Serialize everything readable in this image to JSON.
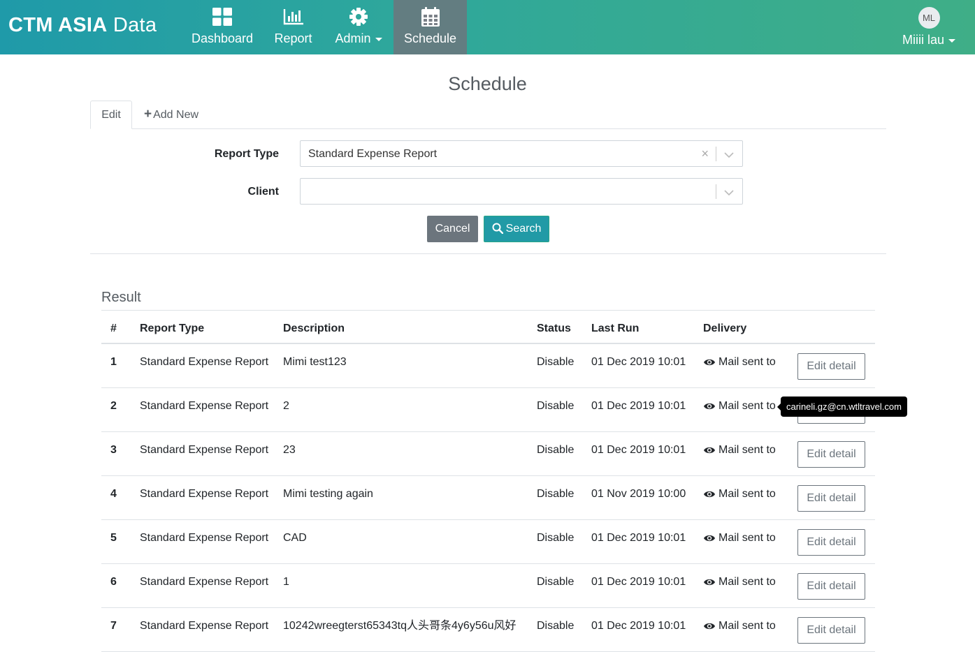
{
  "navbar": {
    "brand_bold": "CTM ASIA",
    "brand_rest": " Data",
    "items": [
      {
        "label": "Dashboard",
        "icon": "dashboard-grid-icon"
      },
      {
        "label": "Report",
        "icon": "bar-chart-icon"
      },
      {
        "label": "Admin",
        "icon": "gear-icon",
        "dropdown": true
      },
      {
        "label": "Schedule",
        "icon": "calendar-icon",
        "active": true
      }
    ],
    "user": {
      "initials": "ML",
      "name": "Miiii lau"
    }
  },
  "page": {
    "title": "Schedule"
  },
  "tabs": {
    "edit": "Edit",
    "add_new": "Add New"
  },
  "form": {
    "report_type_label": "Report Type",
    "report_type_value": "Standard Expense Report",
    "client_label": "Client",
    "client_value": "",
    "cancel_label": "Cancel",
    "search_label": "Search"
  },
  "result": {
    "title": "Result",
    "headers": [
      "#",
      "Report Type",
      "Description",
      "Status",
      "Last Run",
      "Delivery"
    ],
    "rows": [
      {
        "num": "1",
        "type": "Standard Expense Report",
        "desc": "Mimi test123",
        "status": "Disable",
        "last_run": "01 Dec 2019 10:01",
        "delivery": "Mail sent to",
        "action": "Edit detail"
      },
      {
        "num": "2",
        "type": "Standard Expense Report",
        "desc": "2",
        "status": "Disable",
        "last_run": "01 Dec 2019 10:01",
        "delivery": "Mail sent to",
        "action": "Edit detail"
      },
      {
        "num": "3",
        "type": "Standard Expense Report",
        "desc": "23",
        "status": "Disable",
        "last_run": "01 Dec 2019 10:01",
        "delivery": "Mail sent to",
        "action": "Edit detail"
      },
      {
        "num": "4",
        "type": "Standard Expense Report",
        "desc": "Mimi testing again",
        "status": "Disable",
        "last_run": "01 Nov 2019 10:00",
        "delivery": "Mail sent to",
        "action": "Edit detail"
      },
      {
        "num": "5",
        "type": "Standard Expense Report",
        "desc": "CAD",
        "status": "Disable",
        "last_run": "01 Dec 2019 10:01",
        "delivery": "Mail sent to",
        "action": "Edit detail"
      },
      {
        "num": "6",
        "type": "Standard Expense Report",
        "desc": "1",
        "status": "Disable",
        "last_run": "01 Dec 2019 10:01",
        "delivery": "Mail sent to",
        "action": "Edit detail"
      },
      {
        "num": "7",
        "type": "Standard Expense Report",
        "desc": "10242wreegterst65343tq人头哥条4y6y56u风好",
        "status": "Disable",
        "last_run": "01 Dec 2019 10:01",
        "delivery": "Mail sent to",
        "action": "Edit detail"
      }
    ]
  },
  "tooltip": {
    "text": "carineli.gz@cn.wtltravel.com"
  },
  "colors": {
    "navbar_start": "#1f9aa9",
    "navbar_end": "#3fae87",
    "active_nav": "#6c757d",
    "search_button": "#219aa6",
    "cancel_button": "#6c757d"
  }
}
